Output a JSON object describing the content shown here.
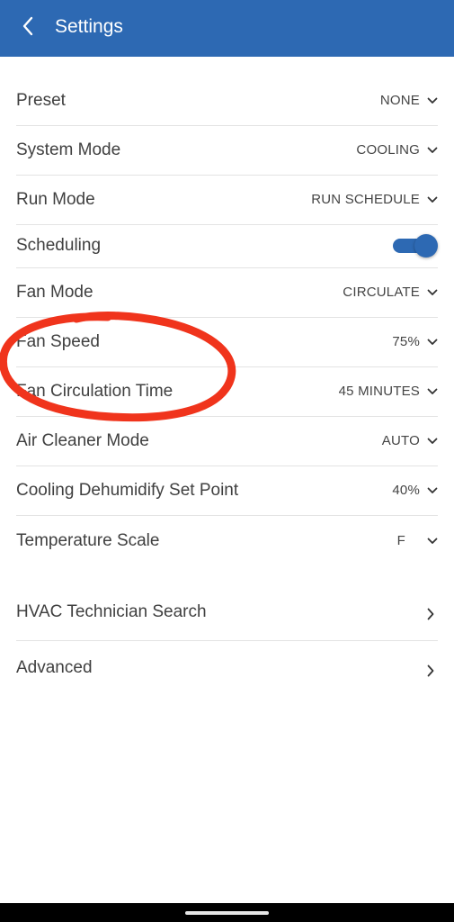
{
  "header": {
    "title": "Settings"
  },
  "settings": [
    {
      "label": "Preset",
      "value": "NONE"
    },
    {
      "label": "System Mode",
      "value": "COOLING"
    },
    {
      "label": "Run Mode",
      "value": "RUN SCHEDULE"
    },
    {
      "label": "Scheduling",
      "toggle_on": true
    },
    {
      "label": "Fan Mode",
      "value": "CIRCULATE"
    },
    {
      "label": "Fan Speed",
      "value": "75%"
    },
    {
      "label": "Fan Circulation Time",
      "value": "45 MINUTES"
    },
    {
      "label": "Air Cleaner Mode",
      "value": "AUTO"
    },
    {
      "label": "Cooling Dehumidify Set Point",
      "value": "40%"
    },
    {
      "label": "Temperature Scale",
      "value": "F"
    }
  ],
  "links": [
    {
      "label": "HVAC Technician Search"
    },
    {
      "label": "Advanced"
    }
  ],
  "colors": {
    "header_bg": "#2d69b3",
    "toggle_on": "#2d69b3",
    "annotation": "#f0341c"
  }
}
